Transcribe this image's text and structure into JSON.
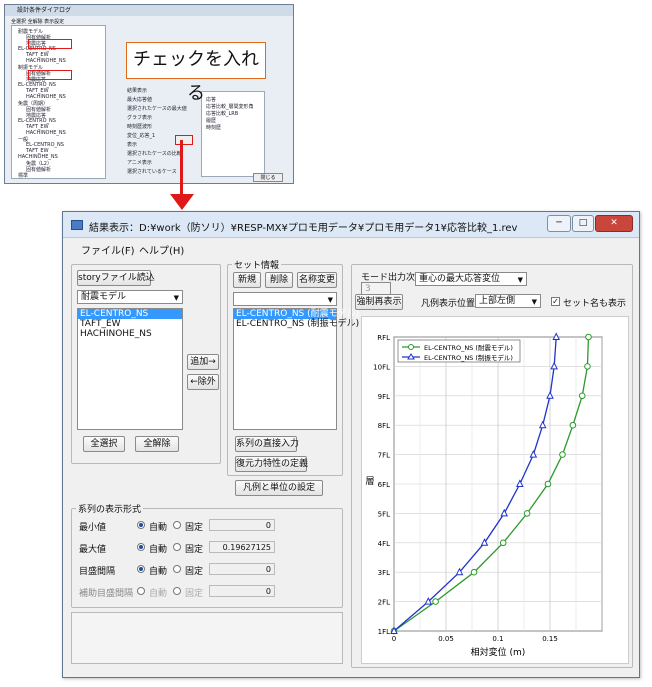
{
  "thumb": {
    "title": "設計条件ダイアログ",
    "tabs": "全選択  全解除  表示設定",
    "tree": [
      "耐震モデル",
      "固有値解析",
      "地震応答",
      "EL-CENTRO_NS",
      "TAFT_EW",
      "HACHINOHE_NS",
      "制振モデル",
      "固有値解析",
      "地震応答",
      "EL-CENTRO_NS",
      "TAFT_EW",
      "HACHINOHE_NS",
      "免震（周期）",
      "固有値解析",
      "地震応答",
      "EL-CENTRO_NS",
      "TAFT_EW",
      "HACHINOHE_NS",
      "一般",
      "EL-CENTRO_NS",
      "TAFT_EW",
      "HACHINOHE_NS",
      "免震（L2）",
      "固有値解析",
      "標準"
    ],
    "panel_lines": [
      "結果表示",
      "最大応答値",
      "選択されたケースの最大値",
      "グラフ表示",
      "時刻歴波形",
      "変位_応答_1",
      "表示",
      "選択されたケースの比較",
      "アニメ表示",
      "選択されているケース"
    ],
    "right_lines": [
      "応答",
      "応答比較_層間変形角",
      "応答比較_LRB",
      "履歴",
      "時刻歴"
    ],
    "close_label": "閉じる"
  },
  "callout": "チェックを入れる",
  "window": {
    "title": "結果表示：D:¥work（防ソリ）¥RESP-MX¥プロモ用データ¥プロモ用データ1¥応答比較_1.rev",
    "min_label": "─",
    "max_label": "□",
    "close_label": "✕"
  },
  "menu": {
    "file": "ファイル(F)",
    "help": "ヘルプ(H)"
  },
  "left": {
    "story_btn": "storyファイル読込",
    "model_combo": "耐震モデル",
    "cases": [
      "EL-CENTRO_NS",
      "TAFT_EW",
      "HACHINOHE_NS"
    ],
    "select_all": "全選択",
    "clear_all": "全解除",
    "add": "追加→",
    "remove": "←除外"
  },
  "set": {
    "group_label": "セット情報",
    "new": "新規",
    "delete": "削除",
    "rename": "名称変更",
    "combo": "",
    "items": [
      "EL-CENTRO_NS (耐震モデル)",
      "EL-CENTRO_NS (制振モデル)"
    ],
    "direct_input": "系列の直接入力",
    "restoring": "復元力特性の定義",
    "legend_unit": "凡例と単位の設定"
  },
  "display": {
    "group_label": "系列の表示形式",
    "rows": [
      {
        "label": "最小値",
        "auto": "自動",
        "fixed": "固定",
        "value": "0"
      },
      {
        "label": "最大値",
        "auto": "自動",
        "fixed": "固定",
        "value": "0.19627125"
      },
      {
        "label": "目盛間隔",
        "auto": "自動",
        "fixed": "固定",
        "value": "0"
      },
      {
        "label": "補助目盛間隔",
        "auto": "自動",
        "fixed": "固定",
        "value": "0"
      }
    ]
  },
  "mode": {
    "label": "モード出力次数",
    "spin_value": "3",
    "combo": "重心の最大応答変位",
    "redraw": "強制再表示",
    "legend_pos_label": "凡例表示位置",
    "legend_pos": "上部左側",
    "set_name_label": "セット名も表示"
  },
  "chart_data": {
    "type": "line",
    "xlabel": "相対変位 (m)",
    "ylabel": "層",
    "xlim": [
      0,
      0.2
    ],
    "x_ticks": [
      "0",
      "0.05",
      "0.1",
      "0.15"
    ],
    "y_categories": [
      "1FL",
      "2FL",
      "3FL",
      "4FL",
      "5FL",
      "6FL",
      "7FL",
      "8FL",
      "9FL",
      "10FL",
      "RFL"
    ],
    "legend_position": "top-left",
    "grid": true,
    "series": [
      {
        "name": "EL-CENTRO_NS (耐震モデル)",
        "color": "#2a9a2a",
        "marker": "circle",
        "values": [
          0,
          0.04,
          0.077,
          0.105,
          0.128,
          0.148,
          0.162,
          0.172,
          0.181,
          0.186,
          0.187
        ]
      },
      {
        "name": "EL-CENTRO_NS (制振モデル)",
        "color": "#2233cc",
        "marker": "triangle",
        "values": [
          0,
          0.033,
          0.063,
          0.087,
          0.106,
          0.121,
          0.134,
          0.143,
          0.15,
          0.154,
          0.156
        ]
      }
    ]
  }
}
